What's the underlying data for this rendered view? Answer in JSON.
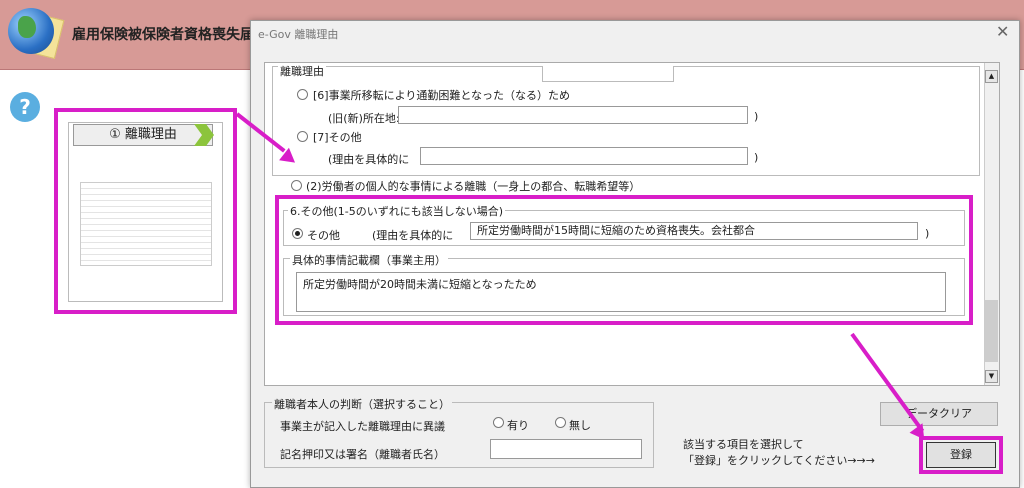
{
  "app": {
    "title": "雇用保険被保険者資格喪失届",
    "help_label": "?"
  },
  "step": {
    "label": "① 離職理由"
  },
  "dialog": {
    "title": "e-Gov  離職理由",
    "close_glyph": "✕"
  },
  "reasons": {
    "group_label": "離職理由",
    "item6_label": "[6]事業所移転により通勤困難となった（なる）ため",
    "item6_field_label": "(旧(新)所在地:",
    "item6_value": "",
    "item7_label": "[7]その他",
    "item7_field_label": "(理由を具体的に",
    "item7_value": "",
    "paren_close": ")",
    "personal_label": "(2)労働者の個人的な事情による離職（一身上の都合、転職希望等）"
  },
  "other": {
    "group_label": "6.その他(1-5のいずれにも該当しない場合)",
    "radio_label": "その他",
    "field_label": "(理由を具体的に",
    "value": "所定労働時間が15時間に短縮のため資格喪失。会社都合",
    "paren_close": ")"
  },
  "detail": {
    "group_label": "具体的事情記載欄（事業主用）",
    "value": "所定労働時間が20時間未満に短縮となったため"
  },
  "judgement": {
    "group_label": "離職者本人の判断（選択すること）",
    "question": "事業主が記入した離職理由に異議",
    "yes_label": "有り",
    "no_label": "無し",
    "sign_label": "記名押印又は署名（離職者氏名）",
    "sign_value": ""
  },
  "actions": {
    "clear_label": "データクリア",
    "hint_line1": "該当する項目を選択して",
    "hint_line2": "「登録」をクリックしてください→→→",
    "register_label": "登録"
  },
  "colors": {
    "highlight": "#d81ec8",
    "appbar": "#d79a96"
  }
}
